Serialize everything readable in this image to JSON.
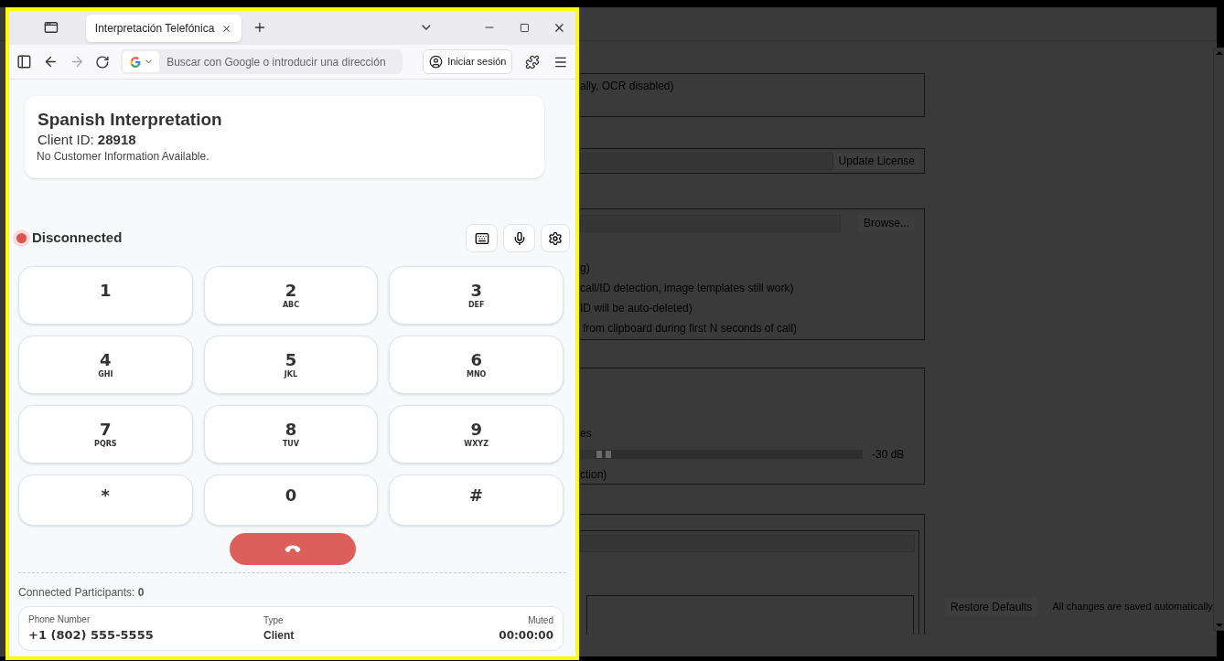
{
  "app": {
    "general": {
      "mode_note": "ally, OCR disabled)"
    },
    "license": {
      "button": "Update License"
    },
    "ocr": {
      "browse": "Browse...",
      "interval_note": "g)",
      "disable_note": "call/ID detection, image templates still work)",
      "min_note": "ID will be auto-deleted)",
      "window_note": "from clipboard during first N seconds of call)"
    },
    "mic": {
      "refresh": "es",
      "threshold": {
        "level": 0.05
      },
      "threshold_reading": "-30 dB",
      "duration_note": "ction)"
    },
    "restore": "Restore Defaults",
    "saved_note": "All changes are saved automatically"
  },
  "browser": {
    "tab": {
      "label": "Interpretación Telefónica",
      "selected": true
    },
    "address_placeholder": "Buscar con Google o introducir una dirección",
    "sign_in": "Iniciar sesión"
  },
  "phone": {
    "title": "Spanish Interpretation",
    "client": "Client ID: **28918**",
    "customer_info": "No Customer Information Available.",
    "status": {
      "label": "Disconnected",
      "connected": false
    },
    "keys": [
      {
        "digit": "1"
      },
      {
        "digit": "2",
        "letters": "ABC"
      },
      {
        "digit": "3",
        "letters": "DEF"
      },
      {
        "digit": "4",
        "letters": "GHI"
      },
      {
        "digit": "5",
        "letters": "JKL"
      },
      {
        "digit": "6",
        "letters": "MNO"
      },
      {
        "digit": "7",
        "letters": "PQRS"
      },
      {
        "digit": "8",
        "letters": "TUV"
      },
      {
        "digit": "9",
        "letters": "WXYZ"
      },
      {
        "digit": "*"
      },
      {
        "digit": "0"
      },
      {
        "digit": "#"
      }
    ],
    "participants": "Connected Participants: **0**",
    "participant": {
      "phone_label": "Phone Number",
      "phone": "+1 (802) 555-5555",
      "type_label": "Type",
      "type": "Client",
      "muted_label": "Muted",
      "timer": "00:00:00"
    }
  }
}
